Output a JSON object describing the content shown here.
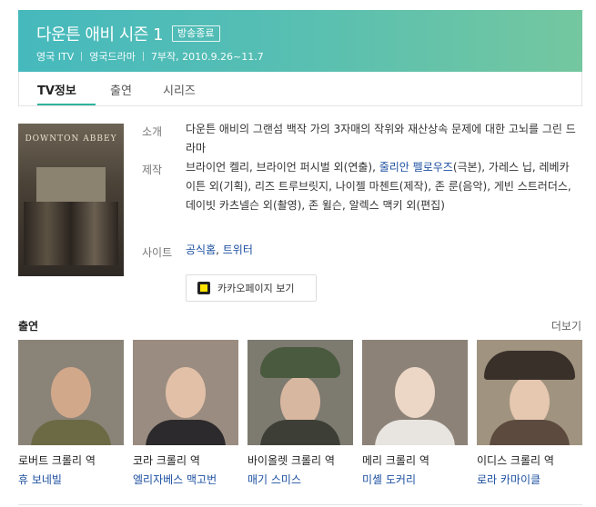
{
  "header": {
    "title": "다운튼 애비 시즌 1",
    "badge": "방송종료",
    "meta": [
      "영국 ITV",
      "영국드라마",
      "7부작, 2010.9.26~11.7"
    ]
  },
  "tabs": [
    {
      "label": "TV정보",
      "active": true
    },
    {
      "label": "출연",
      "active": false
    },
    {
      "label": "시리즈",
      "active": false
    }
  ],
  "poster": {
    "text": "DOWNTON ABBEY"
  },
  "info": {
    "summary_label": "소개",
    "summary": "다운튼 애비의 그랜섬 백작 가의 3자매의 작위와 재산상속 문제에 대한 고뇌를 그린 드라마",
    "credits_label": "제작",
    "credits_before": "브라이언 켈리, 브라이언 퍼시벌 외(연출), ",
    "credits_highlight": "줄리안 펠로우즈",
    "credits_after": "(극본), 가레스 닙, 레베카 이튼 외(기획), 리즈 트루브릿지, 나이젤 마첸트(제작), 존 룬(음악), 게빈 스트러더스, 데이빗 카츠넬슨 외(촬영), 존 윌슨, 알렉스 맥키 외(편집)",
    "site_label": "사이트",
    "site_links": [
      "공식홈",
      "트위터"
    ],
    "site_sep": ", "
  },
  "kakao_button": "카카오페이지 보기",
  "cast": {
    "title": "출연",
    "more": "더보기",
    "items": [
      {
        "role": "로버트 크롤리 역",
        "actor": "휴 보네빌"
      },
      {
        "role": "코라 크롤리 역",
        "actor": "엘리자베스 맥고번"
      },
      {
        "role": "바이올렛 크롤리 역",
        "actor": "매기 스미스"
      },
      {
        "role": "메리 크롤리 역",
        "actor": "미셸 도커리"
      },
      {
        "role": "이디스 크롤리 역",
        "actor": "로라 카마이클"
      }
    ]
  }
}
